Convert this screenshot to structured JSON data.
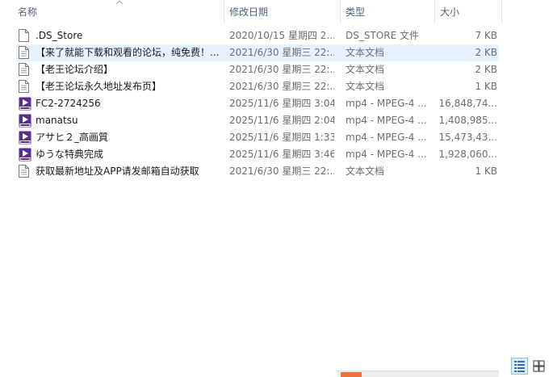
{
  "columns": {
    "name": "名称",
    "date": "修改日期",
    "type": "类型",
    "size": "大小"
  },
  "files": [
    {
      "name": ".DS_Store",
      "date": "2020/10/15 星期四 2...",
      "type": "DS_STORE 文件",
      "size": "7 KB",
      "icon": "generic-file-icon"
    },
    {
      "name": "【来了就能下载和观看的论坛，纯免费！...",
      "date": "2021/6/30 星期三 22:...",
      "type": "文本文档",
      "size": "2 KB",
      "icon": "text-document-icon"
    },
    {
      "name": "【老王论坛介绍】",
      "date": "2021/6/30 星期三 22:...",
      "type": "文本文档",
      "size": "2 KB",
      "icon": "text-document-icon"
    },
    {
      "name": "【老王论坛永久地址发布页】",
      "date": "2021/6/30 星期三 22:...",
      "type": "文本文档",
      "size": "1 KB",
      "icon": "text-document-icon"
    },
    {
      "name": "FC2-2724256",
      "date": "2025/11/6 星期四 3:04",
      "type": "mp4 - MPEG-4 ...",
      "size": "16,848,74...",
      "icon": "mp4-video-icon"
    },
    {
      "name": "manatsu",
      "date": "2025/11/6 星期四 2:04",
      "type": "mp4 - MPEG-4 ...",
      "size": "1,408,985...",
      "icon": "mp4-video-icon"
    },
    {
      "name": "アサヒ２_高画質",
      "date": "2025/11/6 星期四 1:33",
      "type": "mp4 - MPEG-4 ...",
      "size": "15,473,43...",
      "icon": "mp4-video-icon"
    },
    {
      "name": "ゆうな特典完成",
      "date": "2025/11/6 星期四 3:46",
      "type": "mp4 - MPEG-4 ...",
      "size": "1,928,060...",
      "icon": "mp4-video-icon"
    },
    {
      "name": "获取最新地址及APP请发邮箱自动获取",
      "date": "2021/6/30 星期三 22:...",
      "type": "文本文档",
      "size": "1 KB",
      "icon": "text-document-icon"
    }
  ],
  "highlighted_row": 1,
  "colors": {
    "header_text": "#4c607a",
    "hover_row": "#e5f3ff",
    "mp4_icon": "#5b2c91"
  }
}
